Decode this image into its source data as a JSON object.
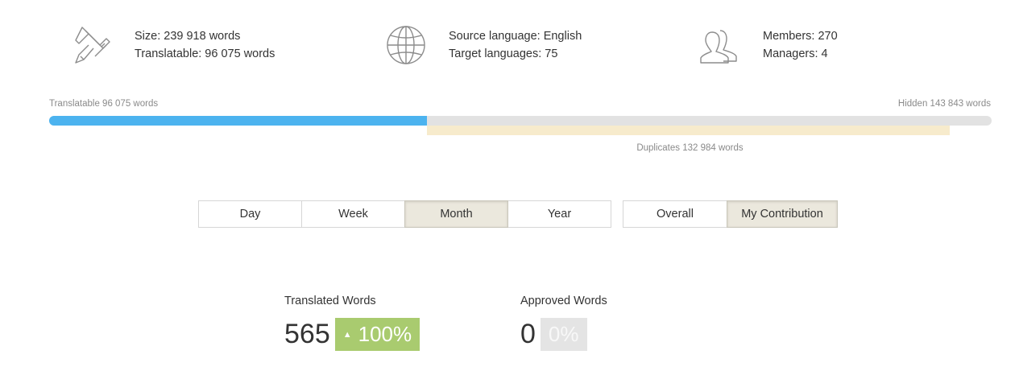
{
  "stats": {
    "size": {
      "icon": "caliper-icon",
      "size_text": "Size: 239 918 words",
      "translatable_text": "Translatable: 96 075 words"
    },
    "languages": {
      "icon": "globe-icon",
      "source_text": "Source language: English",
      "target_text": "Target languages: 75"
    },
    "members": {
      "icon": "users-icon",
      "members_text": "Members: 270",
      "managers_text": "Managers: 4"
    }
  },
  "progress": {
    "translatable_label": "Translatable 96 075 words",
    "hidden_label": "Hidden 143 843 words",
    "duplicates_label": "Duplicates 132 984 words",
    "translatable_fraction": 0.4005,
    "duplicates_fraction": 0.5543,
    "colors": {
      "translatable": "#4cb3ef",
      "hidden": "#e2e2e2",
      "duplicates": "#f7ebcc"
    }
  },
  "period_tabs": [
    {
      "label": "Day",
      "active": false
    },
    {
      "label": "Week",
      "active": false
    },
    {
      "label": "Month",
      "active": true
    },
    {
      "label": "Year",
      "active": false
    }
  ],
  "scope_tabs": [
    {
      "label": "Overall",
      "active": false
    },
    {
      "label": "My Contribution",
      "active": true
    }
  ],
  "metrics": {
    "translated": {
      "title": "Translated Words",
      "value": "565",
      "change": "100%",
      "arrow": "▲",
      "color": "#a9cb6f"
    },
    "approved": {
      "title": "Approved Words",
      "value": "0",
      "change": "0%",
      "color": "#e4e4e4"
    }
  }
}
